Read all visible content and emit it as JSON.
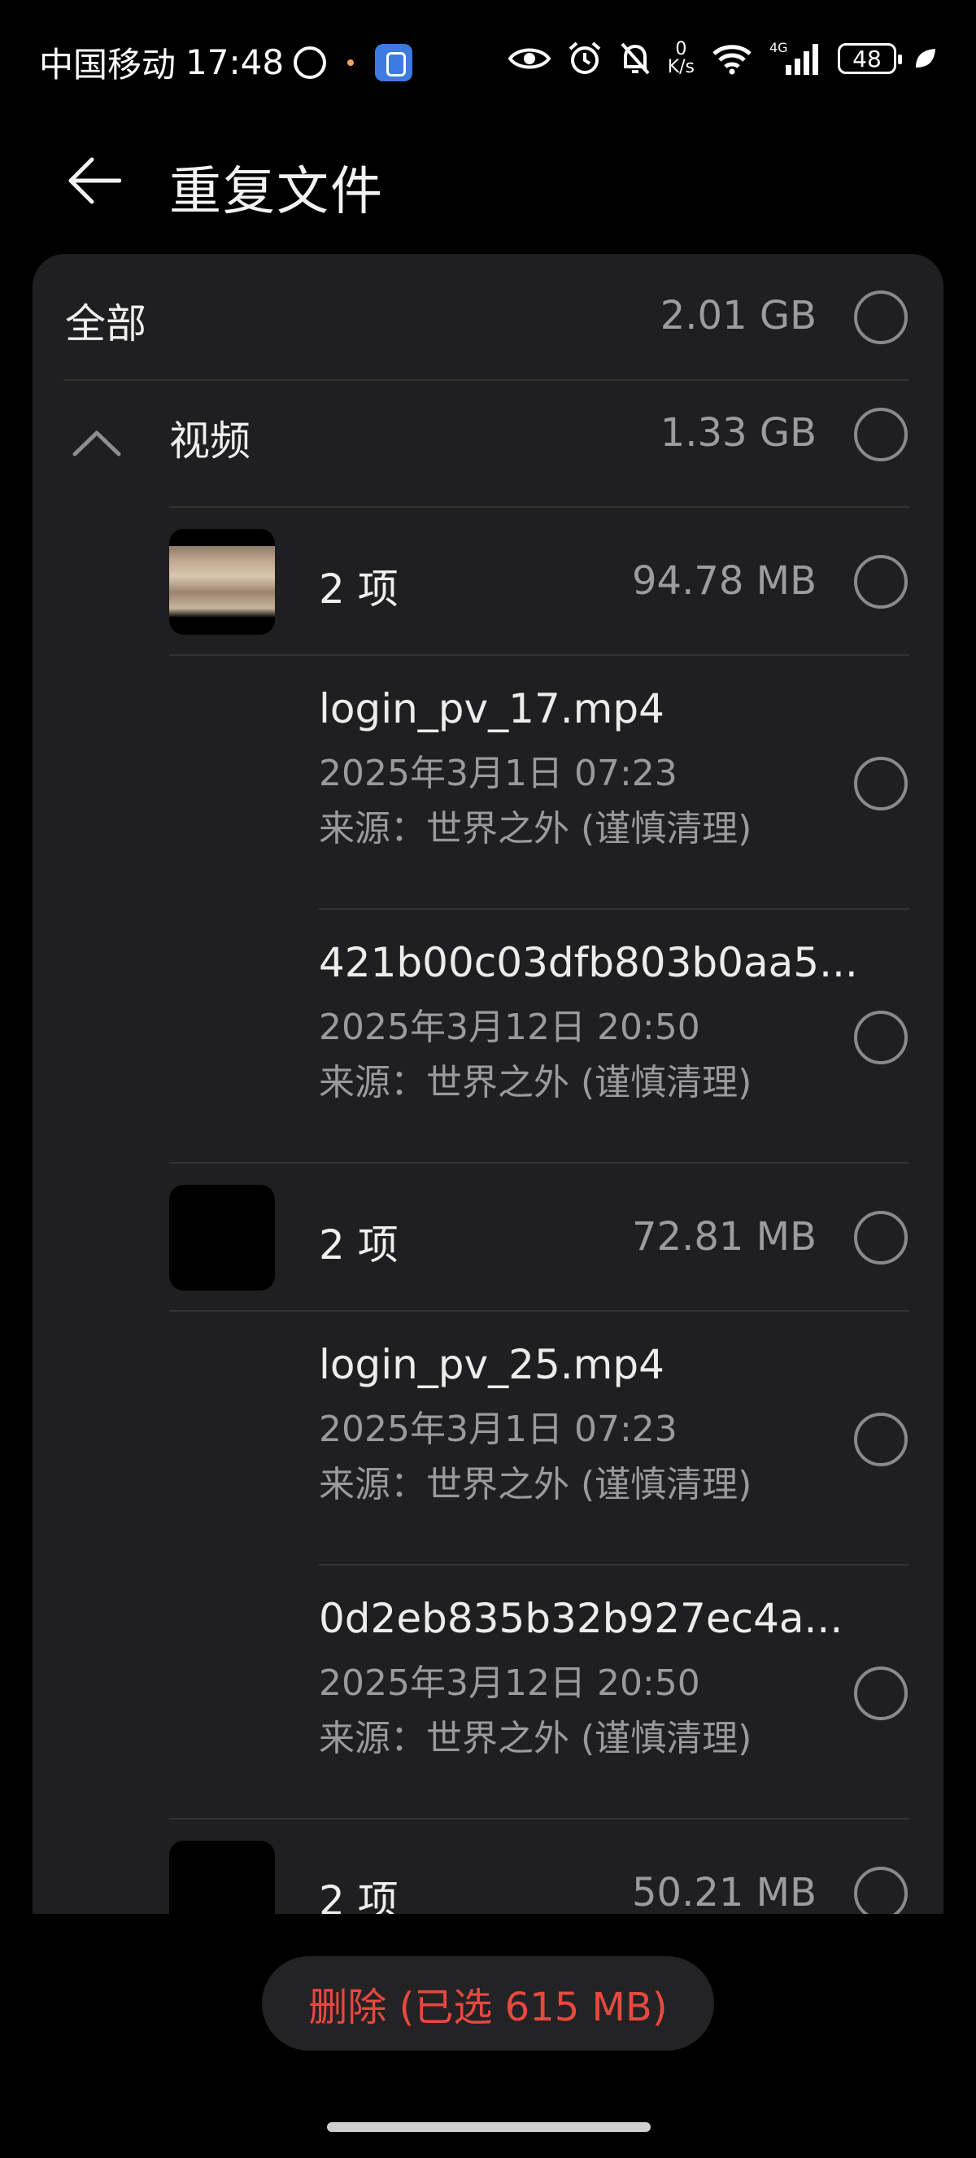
{
  "status_bar": {
    "carrier": "中国移动",
    "time": "17:48",
    "net_speed_value": "0",
    "net_speed_unit": "K/s",
    "network_type": "4G",
    "battery": "48"
  },
  "header": {
    "title": "重复文件"
  },
  "all_row": {
    "label": "全部",
    "size": "2.01 GB"
  },
  "video_section": {
    "label": "视频",
    "size": "1.33 GB"
  },
  "groups": [
    {
      "count_label": "2 项",
      "size": "94.78 MB",
      "files": [
        {
          "name": "login_pv_17.mp4",
          "date": "2025年3月1日 07:23",
          "source": "来源：世界之外 (谨慎清理)"
        },
        {
          "name": "421b00c03dfb803b0aa5...",
          "date": "2025年3月12日 20:50",
          "source": "来源：世界之外 (谨慎清理)"
        }
      ]
    },
    {
      "count_label": "2 项",
      "size": "72.81 MB",
      "files": [
        {
          "name": "login_pv_25.mp4",
          "date": "2025年3月1日 07:23",
          "source": "来源：世界之外 (谨慎清理)"
        },
        {
          "name": "0d2eb835b32b927ec4a...",
          "date": "2025年3月12日 20:50",
          "source": "来源：世界之外 (谨慎清理)"
        }
      ]
    },
    {
      "count_label": "2 项",
      "size": "50.21 MB",
      "files": []
    }
  ],
  "footer": {
    "delete_label": "删除 (已选 615 MB)"
  },
  "colors": {
    "background": "#000000",
    "card": "#1f1f21",
    "delete_text": "#e8493f"
  }
}
